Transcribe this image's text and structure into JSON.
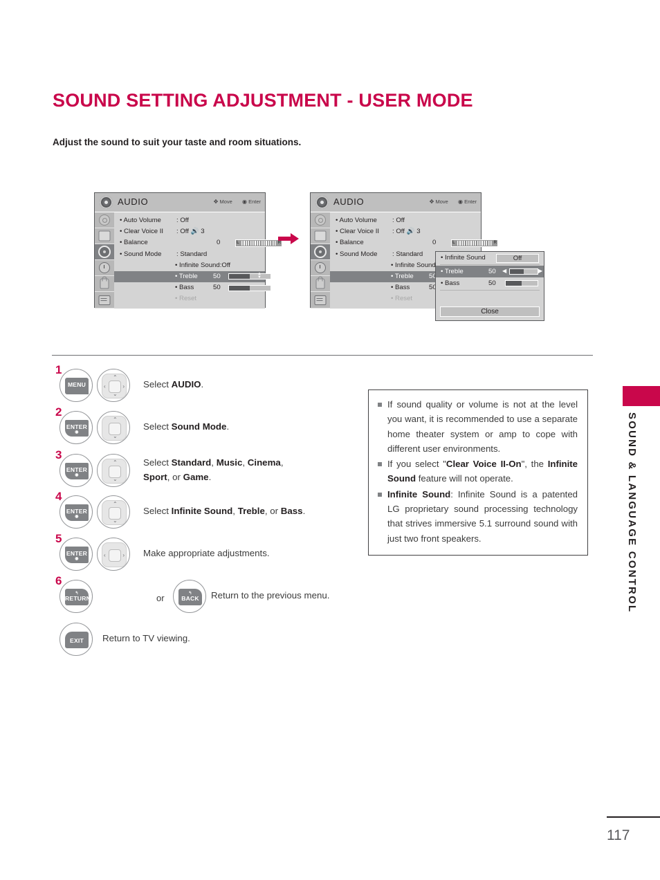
{
  "page": {
    "title": "SOUND SETTING ADJUSTMENT - USER MODE",
    "intro": "Adjust the sound to suit your taste and room situations.",
    "number": "117",
    "side_tab_label": "SOUND & LANGUAGE CONTROL",
    "accent_color": "#c9074b"
  },
  "osd": {
    "title": "AUDIO",
    "hint_move": "Move",
    "hint_enter": "Enter",
    "rows": {
      "auto_volume_label": "• Auto Volume",
      "auto_volume_value": ": Off",
      "clear_voice_label": "• Clear Voice II",
      "clear_voice_value": ": Off",
      "clear_voice_level": "3",
      "balance_label": "• Balance",
      "balance_value": "0",
      "balance_left": "L",
      "balance_right": "R",
      "sound_mode_label": "• Sound Mode",
      "sound_mode_value": ": Standard",
      "infinite_sound_label": "• Infinite Sound:Off",
      "infinite_sound_label_clipped": "• Infinite Sound:",
      "treble_label": "• Treble",
      "treble_value": "50",
      "bass_label": "• Bass",
      "bass_value": "50",
      "reset_label": "• Reset"
    },
    "tabs": [
      "picture-icon",
      "screen-icon",
      "audio-icon",
      "time-icon",
      "lock-icon",
      "option-icon"
    ]
  },
  "popup": {
    "infinite_sound_label": "• Infinite Sound",
    "infinite_sound_value": "Off",
    "treble_label": "• Treble",
    "treble_value": "50",
    "bass_label": "• Bass",
    "bass_value": "50",
    "close_label": "Close"
  },
  "steps": [
    {
      "num": "1",
      "key": "MENU",
      "key2": "",
      "dpad": "four-way",
      "text_html": "Select <b>AUDIO</b>."
    },
    {
      "num": "2",
      "key": "ENTER",
      "key2": "",
      "dpad": "up-down",
      "text_html": "Select <b>Sound Mode</b>."
    },
    {
      "num": "3",
      "key": "ENTER",
      "key2": "",
      "dpad": "up-down",
      "text_html": "Select <b>Standard</b>, <b>Music</b>, <b>Cinema</b>,<br><b>Sport</b>, or <b>Game</b>."
    },
    {
      "num": "4",
      "key": "ENTER",
      "key2": "",
      "dpad": "up-down",
      "text_html": "Select <b>Infinite Sound</b>, <b>Treble</b>, or <b>Bass</b>."
    },
    {
      "num": "5",
      "key": "ENTER",
      "key2": "",
      "dpad": "left-right",
      "text_html": "Make appropriate adjustments."
    },
    {
      "num": "6",
      "key": "RETURN",
      "key2": "BACK",
      "or_label": "or",
      "dpad": "",
      "text_html": "Return to the previous menu."
    },
    {
      "num": "",
      "key": "EXIT",
      "key2": "",
      "dpad": "",
      "text_html": "Return to TV viewing."
    }
  ],
  "notes": [
    "If sound quality or volume is not at the level you want, it is recommended to use a separate home theater system or amp to cope with different user environments.",
    "If you select \"<b>Clear Voice II-On</b>\", the <b>Infinite Sound</b> feature will not operate.",
    "<b>Infinite Sound</b>: Infinite Sound is a patented LG proprietary sound processing technology that strives immersive 5.1 surround sound with just two front speakers."
  ]
}
